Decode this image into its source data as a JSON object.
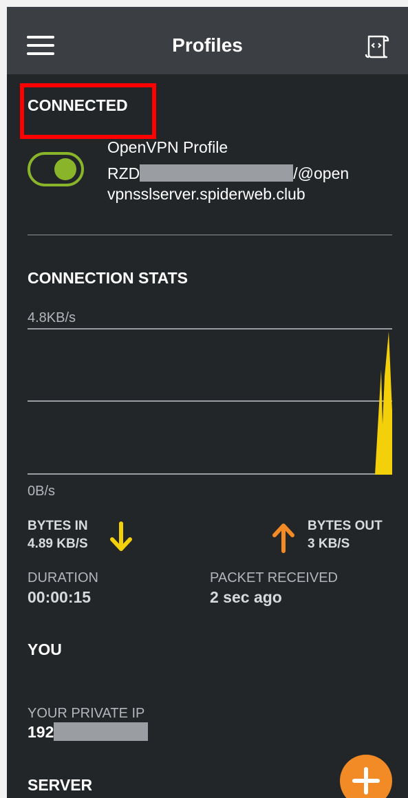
{
  "header": {
    "title": "Profiles"
  },
  "status": {
    "label": "CONNECTED"
  },
  "profile": {
    "name": "OpenVPN Profile",
    "user_prefix": "RZD",
    "user_suffix": "/@open",
    "host": "vpnsslserver.spiderweb.club",
    "toggle_on": true
  },
  "stats": {
    "heading": "CONNECTION STATS",
    "y_max_label": "4.8KB/s",
    "y_min_label": "0B/s",
    "bytes_in_label": "BYTES IN",
    "bytes_in_value": "4.89 KB/S",
    "bytes_out_label": "BYTES OUT",
    "bytes_out_value": "3 KB/S",
    "duration_label": "DURATION",
    "duration_value": "00:00:15",
    "packet_label": "PACKET RECEIVED",
    "packet_value": "2 sec ago"
  },
  "you": {
    "heading": "YOU",
    "private_ip_label": "YOUR PRIVATE IP",
    "private_ip_prefix": "192"
  },
  "server": {
    "heading": "SERVER"
  },
  "colors": {
    "accent_green": "#8ab52a",
    "bytes_in_arrow": "#f4d00a",
    "bytes_out_arrow": "#f28a25",
    "fab": "#f28a25",
    "chart_fill": "#f4d00a",
    "highlight_box": "#ff0000"
  },
  "icons": {
    "menu": "hamburger-menu-icon",
    "log": "log-file-icon",
    "bytes_in": "arrow-down-icon",
    "bytes_out": "arrow-up-icon",
    "add": "plus-icon"
  }
}
